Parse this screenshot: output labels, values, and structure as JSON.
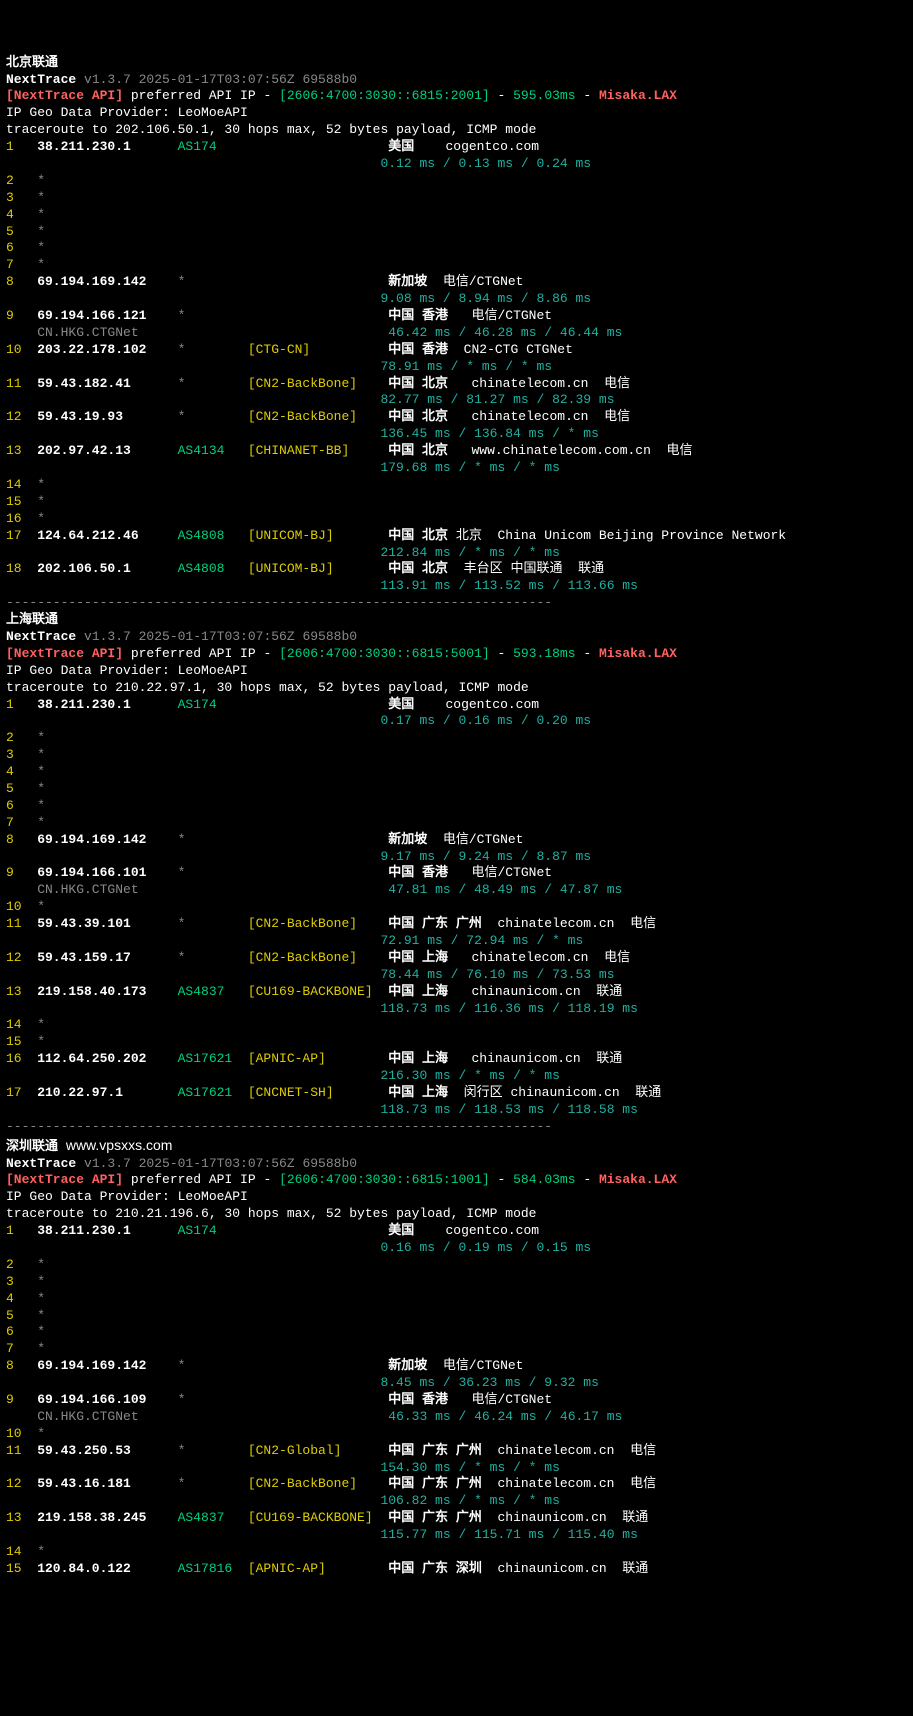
{
  "sections": [
    {
      "title": "北京联通",
      "nexttrace": "NextTrace",
      "version": "v1.3.7 2025-01-17T03:07:56Z 69588b0",
      "api_prefix": "[NextTrace API]",
      "api_text": " preferred API IP - ",
      "api_ip": "[2606:4700:3030::6815:2001]",
      "api_rtt": "595.03ms",
      "api_node": "Misaka.LAX",
      "geo": "IP Geo Data Provider: LeoMoeAPI",
      "traceroute": "traceroute to 202.106.50.1, 30 hops max, 52 bytes payload, ICMP mode",
      "hops": [
        {
          "n": "1",
          "ip": "38.211.230.1",
          "as": "AS174",
          "tag": "",
          "loc": "美国",
          "extra": "    cogentco.com",
          "rtt": "0.12 ms / 0.13 ms / 0.24 ms"
        },
        {
          "n": "2",
          "ip": "*"
        },
        {
          "n": "3",
          "ip": "*"
        },
        {
          "n": "4",
          "ip": "*"
        },
        {
          "n": "5",
          "ip": "*"
        },
        {
          "n": "6",
          "ip": "*"
        },
        {
          "n": "7",
          "ip": "*"
        },
        {
          "n": "8",
          "ip": "69.194.169.142",
          "as": "*",
          "tag": "",
          "loc": "新加坡",
          "extra": "  电信/CTGNet",
          "rtt": "9.08 ms / 8.94 ms / 8.86 ms"
        },
        {
          "n": "9",
          "ip": "69.194.166.121",
          "as": "*",
          "tag": "",
          "loc": "中国 香港",
          "extra": "   电信/CTGNet",
          "rtt": "46.42 ms / 46.28 ms / 46.44 ms",
          "sub": "CN.HKG.CTGNet"
        },
        {
          "n": "10",
          "ip": "203.22.178.102",
          "as": "*",
          "tag": "[CTG-CN]",
          "loc": "中国 香港",
          "extra": "  CN2-CTG CTGNet",
          "rtt": "78.91 ms / * ms / * ms",
          "tagc": "yellow"
        },
        {
          "n": "11",
          "ip": "59.43.182.41",
          "as": "*",
          "tag": "[CN2-BackBone]",
          "loc": "中国 北京",
          "extra": "   chinatelecom.cn  电信",
          "rtt": "82.77 ms / 81.27 ms / 82.39 ms",
          "tagc": "yellow"
        },
        {
          "n": "12",
          "ip": "59.43.19.93",
          "as": "*",
          "tag": "[CN2-BackBone]",
          "loc": "中国 北京",
          "extra": "   chinatelecom.cn  电信",
          "rtt": "136.45 ms / 136.84 ms / * ms",
          "tagc": "yellow"
        },
        {
          "n": "13",
          "ip": "202.97.42.13",
          "as": "AS4134",
          "tag": "[CHINANET-BB]",
          "loc": "中国 北京",
          "extra": "   www.chinatelecom.com.cn  电信",
          "rtt": "179.68 ms / * ms / * ms",
          "tagc": "yellow"
        },
        {
          "n": "14",
          "ip": "*"
        },
        {
          "n": "15",
          "ip": "*"
        },
        {
          "n": "16",
          "ip": "*"
        },
        {
          "n": "17",
          "ip": "124.64.212.46",
          "as": "AS4808",
          "tag": "[UNICOM-BJ]",
          "loc": "中国 北京",
          "extra": " 北京  China Unicom Beijing Province Network",
          "rtt": "212.84 ms / * ms / * ms",
          "tagc": "yellow"
        },
        {
          "n": "18",
          "ip": "202.106.50.1",
          "as": "AS4808",
          "tag": "[UNICOM-BJ]",
          "loc": "中国 北京",
          "extra": "  丰台区 中国联通  联通",
          "rtt": "113.91 ms / 113.52 ms / 113.66 ms",
          "tagc": "yellow"
        }
      ]
    },
    {
      "title": "上海联通",
      "nexttrace": "NextTrace",
      "version": "v1.3.7 2025-01-17T03:07:56Z 69588b0",
      "api_prefix": "[NextTrace API]",
      "api_text": " preferred API IP - ",
      "api_ip": "[2606:4700:3030::6815:5001]",
      "api_rtt": "593.18ms",
      "api_node": "Misaka.LAX",
      "geo": "IP Geo Data Provider: LeoMoeAPI",
      "traceroute": "traceroute to 210.22.97.1, 30 hops max, 52 bytes payload, ICMP mode",
      "hops": [
        {
          "n": "1",
          "ip": "38.211.230.1",
          "as": "AS174",
          "tag": "",
          "loc": "美国",
          "extra": "    cogentco.com",
          "rtt": "0.17 ms / 0.16 ms / 0.20 ms"
        },
        {
          "n": "2",
          "ip": "*"
        },
        {
          "n": "3",
          "ip": "*"
        },
        {
          "n": "4",
          "ip": "*"
        },
        {
          "n": "5",
          "ip": "*"
        },
        {
          "n": "6",
          "ip": "*"
        },
        {
          "n": "7",
          "ip": "*"
        },
        {
          "n": "8",
          "ip": "69.194.169.142",
          "as": "*",
          "tag": "",
          "loc": "新加坡",
          "extra": "  电信/CTGNet",
          "rtt": "9.17 ms / 9.24 ms / 8.87 ms"
        },
        {
          "n": "9",
          "ip": "69.194.166.101",
          "as": "*",
          "tag": "",
          "loc": "中国 香港",
          "extra": "   电信/CTGNet",
          "rtt": "47.81 ms / 48.49 ms / 47.87 ms",
          "sub": "CN.HKG.CTGNet"
        },
        {
          "n": "10",
          "ip": "*"
        },
        {
          "n": "11",
          "ip": "59.43.39.101",
          "as": "*",
          "tag": "[CN2-BackBone]",
          "loc": "中国 广东 广州",
          "extra": "  chinatelecom.cn  电信",
          "rtt": "72.91 ms / 72.94 ms / * ms",
          "tagc": "yellow"
        },
        {
          "n": "12",
          "ip": "59.43.159.17",
          "as": "*",
          "tag": "[CN2-BackBone]",
          "loc": "中国 上海",
          "extra": "   chinatelecom.cn  电信",
          "rtt": "78.44 ms / 76.10 ms / 73.53 ms",
          "tagc": "yellow"
        },
        {
          "n": "13",
          "ip": "219.158.40.173",
          "as": "AS4837",
          "tag": "[CU169-BACKBONE]",
          "loc": "中国 上海",
          "extra": "   chinaunicom.cn  联通",
          "rtt": "118.73 ms / 116.36 ms / 118.19 ms",
          "tagc": "yellow"
        },
        {
          "n": "14",
          "ip": "*"
        },
        {
          "n": "15",
          "ip": "*"
        },
        {
          "n": "16",
          "ip": "112.64.250.202",
          "as": "AS17621",
          "tag": "[APNIC-AP]",
          "loc": "中国 上海",
          "extra": "   chinaunicom.cn  联通",
          "rtt": "216.30 ms / * ms / * ms",
          "tagc": "yellow"
        },
        {
          "n": "17",
          "ip": "210.22.97.1",
          "as": "AS17621",
          "tag": "[CNCNET-SH]",
          "loc": "中国 上海",
          "extra": "  闵行区 chinaunicom.cn  联通",
          "rtt": "118.73 ms / 118.53 ms / 118.58 ms",
          "tagc": "yellow"
        }
      ]
    },
    {
      "title": "深圳联通",
      "watermark": "www.vpsxxs.com",
      "nexttrace": "NextTrace",
      "version": "v1.3.7 2025-01-17T03:07:56Z 69588b0",
      "api_prefix": "[NextTrace API]",
      "api_text": " preferred API IP - ",
      "api_ip": "[2606:4700:3030::6815:1001]",
      "api_rtt": "584.03ms",
      "api_node": "Misaka.LAX",
      "geo": "IP Geo Data Provider: LeoMoeAPI",
      "traceroute": "traceroute to 210.21.196.6, 30 hops max, 52 bytes payload, ICMP mode",
      "hops": [
        {
          "n": "1",
          "ip": "38.211.230.1",
          "as": "AS174",
          "tag": "",
          "loc": "美国",
          "extra": "    cogentco.com",
          "rtt": "0.16 ms / 0.19 ms / 0.15 ms"
        },
        {
          "n": "2",
          "ip": "*"
        },
        {
          "n": "3",
          "ip": "*"
        },
        {
          "n": "4",
          "ip": "*"
        },
        {
          "n": "5",
          "ip": "*"
        },
        {
          "n": "6",
          "ip": "*"
        },
        {
          "n": "7",
          "ip": "*"
        },
        {
          "n": "8",
          "ip": "69.194.169.142",
          "as": "*",
          "tag": "",
          "loc": "新加坡",
          "extra": "  电信/CTGNet",
          "rtt": "8.45 ms / 36.23 ms / 9.32 ms"
        },
        {
          "n": "9",
          "ip": "69.194.166.109",
          "as": "*",
          "tag": "",
          "loc": "中国 香港",
          "extra": "   电信/CTGNet",
          "rtt": "46.33 ms / 46.24 ms / 46.17 ms",
          "sub": "CN.HKG.CTGNet"
        },
        {
          "n": "10",
          "ip": "*"
        },
        {
          "n": "11",
          "ip": "59.43.250.53",
          "as": "*",
          "tag": "[CN2-Global]",
          "loc": "中国 广东 广州",
          "extra": "  chinatelecom.cn  电信",
          "rtt": "154.30 ms / * ms / * ms",
          "tagc": "yellow"
        },
        {
          "n": "12",
          "ip": "59.43.16.181",
          "as": "*",
          "tag": "[CN2-BackBone]",
          "loc": "中国 广东 广州",
          "extra": "  chinatelecom.cn  电信",
          "rtt": "106.82 ms / * ms / * ms",
          "tagc": "yellow"
        },
        {
          "n": "13",
          "ip": "219.158.38.245",
          "as": "AS4837",
          "tag": "[CU169-BACKBONE]",
          "loc": "中国 广东 广州",
          "extra": "  chinaunicom.cn  联通",
          "rtt": "115.77 ms / 115.71 ms / 115.40 ms",
          "tagc": "yellow"
        },
        {
          "n": "14",
          "ip": "*"
        },
        {
          "n": "15",
          "ip": "120.84.0.122",
          "as": "AS17816",
          "tag": "[APNIC-AP]",
          "loc": "中国 广东 深圳",
          "extra": "  chinaunicom.cn  联通",
          "tagc": "yellow"
        }
      ]
    }
  ],
  "divider": "----------------------------------------------------------------------"
}
